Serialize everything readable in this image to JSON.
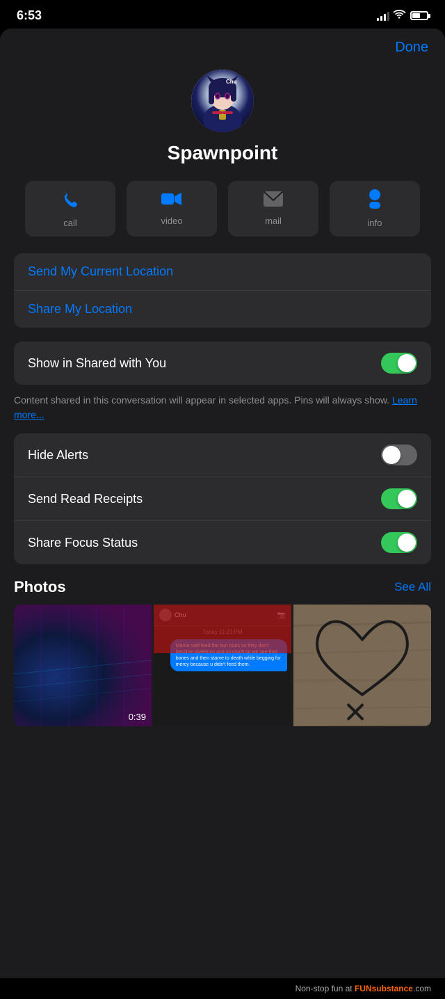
{
  "statusBar": {
    "time": "6:53",
    "batteryLevel": 55
  },
  "header": {
    "doneLabel": "Done"
  },
  "profile": {
    "name": "Spawnpoint"
  },
  "actionButtons": [
    {
      "id": "call",
      "label": "call",
      "icon": "📞",
      "colorClass": "blue"
    },
    {
      "id": "video",
      "label": "video",
      "icon": "📹",
      "colorClass": "blue"
    },
    {
      "id": "mail",
      "label": "mail",
      "icon": "✉️",
      "colorClass": "gray"
    },
    {
      "id": "info",
      "label": "info",
      "icon": "👤",
      "colorClass": "blue"
    }
  ],
  "locationSection": {
    "sendCurrentLocation": "Send My Current Location",
    "shareMyLocation": "Share My Location"
  },
  "sharedWithYou": {
    "label": "Show in Shared with You",
    "enabled": true,
    "description": "Content shared in this conversation will appear in selected apps. Pins will always show.",
    "learnMore": "Learn more..."
  },
  "toggleSettings": [
    {
      "id": "hide-alerts",
      "label": "Hide Alerts",
      "enabled": false
    },
    {
      "id": "send-read-receipts",
      "label": "Send Read Receipts",
      "enabled": true
    },
    {
      "id": "share-focus-status",
      "label": "Share Focus Status",
      "enabled": true
    }
  ],
  "photos": {
    "title": "Photos",
    "seeAllLabel": "See All",
    "items": [
      {
        "id": "photo-1",
        "type": "video",
        "duration": "0:39"
      },
      {
        "id": "photo-2",
        "type": "chat-screenshot"
      },
      {
        "id": "photo-3",
        "type": "heart-drawing"
      }
    ],
    "chatContent": "Mama said feed the bun buns so they don't become skeletons and so much so we see their bones and then starve to death while begging for mercy because u didn't feed them."
  },
  "watermark": {
    "prefix": "Non-stop fun at ",
    "brand": "FUNsubstance",
    "suffix": ".com"
  }
}
